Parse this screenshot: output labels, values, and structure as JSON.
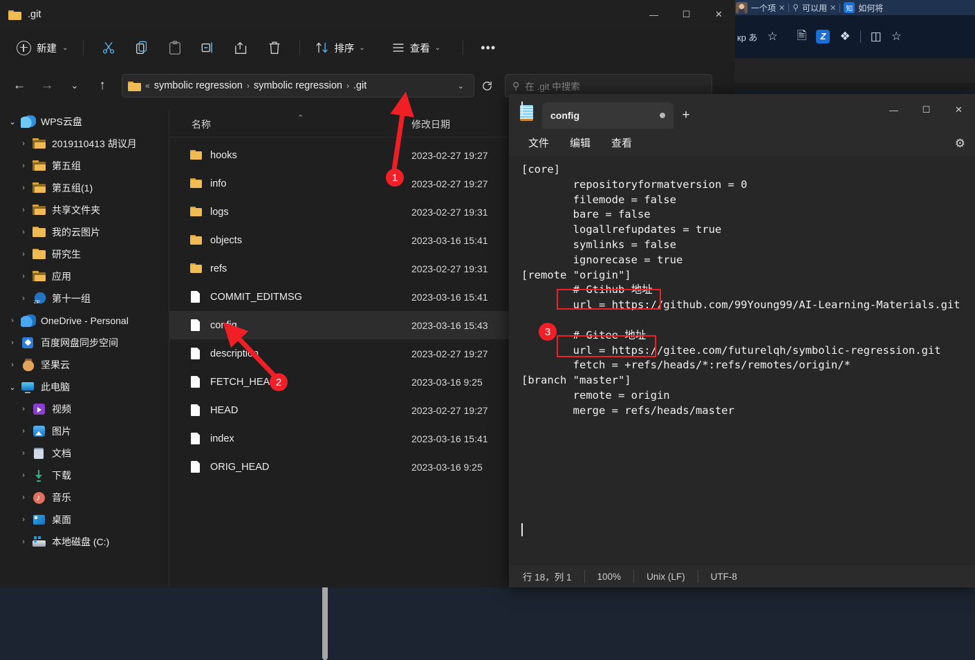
{
  "browser": {
    "tabs": [
      {
        "title": "一个项",
        "close": "✕"
      },
      {
        "title": "可以用",
        "close": "✕"
      },
      {
        "title": "如何将",
        "close": ""
      }
    ],
    "search_icon": "search-icon",
    "toolbar_icons": [
      "ime-indicator",
      "add-favorite-icon",
      "collections-icon",
      "zotero-icon",
      "extensions-icon",
      "split-screen-icon",
      "favorites-icon"
    ],
    "ime_label": "кр あ"
  },
  "explorer": {
    "title": ".git",
    "window_controls": {
      "minimize": "—",
      "maximize": "☐",
      "close": "✕"
    },
    "toolbar": {
      "new_label": "新建",
      "new_chevron": "⌄",
      "cut_icon": "cut-icon",
      "copy_icon": "copy-icon",
      "paste_icon": "paste-icon",
      "rename_icon": "rename-icon",
      "share_icon": "share-icon",
      "delete_icon": "delete-icon",
      "sort_label": "排序",
      "sort_icon": "sort-icon",
      "view_label": "查看",
      "view_icon": "view-icon",
      "more_label": "•••"
    },
    "nav": {
      "back": "←",
      "forward": "→",
      "recent": "⌄",
      "up": "↑",
      "refresh_icon": "refresh-icon",
      "breadcrumb_overflow": "«",
      "breadcrumb": [
        "symbolic regression",
        "symbolic regression",
        ".git"
      ],
      "breadcrumb_sep": "›",
      "breadcrumb_dropdown": "⌄",
      "search_placeholder": "在 .git 中搜索"
    },
    "navpane": [
      {
        "label": "WPS云盘",
        "icon": "cloud-wps-icon",
        "expander": "⌄",
        "expanded": true,
        "indent": 0
      },
      {
        "label": "2019110413 胡议月",
        "icon": "folder-shared-icon",
        "expander": "›",
        "indent": 1
      },
      {
        "label": "第五组",
        "icon": "folder-shared-icon",
        "expander": "›",
        "indent": 1
      },
      {
        "label": "第五组(1)",
        "icon": "folder-shared-icon",
        "expander": "›",
        "indent": 1
      },
      {
        "label": "共享文件夹",
        "icon": "folder-shared-icon",
        "expander": "›",
        "indent": 1
      },
      {
        "label": "我的云图片",
        "icon": "folder-icon",
        "expander": "›",
        "indent": 1
      },
      {
        "label": "研究生",
        "icon": "folder-icon",
        "expander": "›",
        "indent": 1
      },
      {
        "label": "应用",
        "icon": "folder-app-icon",
        "expander": "›",
        "indent": 1
      },
      {
        "label": "第十一组",
        "icon": "zip-icon",
        "expander": "›",
        "indent": 1
      },
      {
        "label": "OneDrive - Personal",
        "icon": "cloud-onedrive-icon",
        "expander": "›",
        "indent": 0
      },
      {
        "label": "百度网盘同步空间",
        "icon": "baidu-netdisk-icon",
        "expander": "›",
        "indent": 0
      },
      {
        "label": "坚果云",
        "icon": "nutstore-icon",
        "expander": "›",
        "indent": 0
      },
      {
        "label": "此电脑",
        "icon": "this-pc-icon",
        "expander": "⌄",
        "expanded": true,
        "indent": 0
      },
      {
        "label": "视频",
        "icon": "videos-icon",
        "expander": "›",
        "indent": 1
      },
      {
        "label": "图片",
        "icon": "pictures-icon",
        "expander": "›",
        "indent": 1
      },
      {
        "label": "文档",
        "icon": "documents-icon",
        "expander": "›",
        "indent": 1
      },
      {
        "label": "下载",
        "icon": "downloads-icon",
        "expander": "›",
        "indent": 1
      },
      {
        "label": "音乐",
        "icon": "music-icon",
        "expander": "›",
        "indent": 1
      },
      {
        "label": "桌面",
        "icon": "desktop-icon",
        "expander": "›",
        "indent": 1
      },
      {
        "label": "本地磁盘 (C:)",
        "icon": "disk-icon",
        "expander": "›",
        "indent": 1
      }
    ],
    "columns": {
      "name": "名称",
      "date": "修改日期",
      "sort_caret": "⌃"
    },
    "files": [
      {
        "name": "hooks",
        "date": "2023-02-27 19:27",
        "type": "folder",
        "selected": false
      },
      {
        "name": "info",
        "date": "2023-02-27 19:27",
        "type": "folder",
        "selected": false
      },
      {
        "name": "logs",
        "date": "2023-02-27 19:31",
        "type": "folder",
        "selected": false
      },
      {
        "name": "objects",
        "date": "2023-03-16 15:41",
        "type": "folder",
        "selected": false
      },
      {
        "name": "refs",
        "date": "2023-02-27 19:31",
        "type": "folder",
        "selected": false
      },
      {
        "name": "COMMIT_EDITMSG",
        "date": "2023-03-16 15:41",
        "type": "file",
        "selected": false
      },
      {
        "name": "config",
        "date": "2023-03-16 15:43",
        "type": "file",
        "selected": true
      },
      {
        "name": "description",
        "date": "2023-02-27 19:27",
        "type": "file",
        "selected": false
      },
      {
        "name": "FETCH_HEAD",
        "date": "2023-03-16 9:25",
        "type": "file",
        "selected": false
      },
      {
        "name": "HEAD",
        "date": "2023-02-27 19:27",
        "type": "file",
        "selected": false
      },
      {
        "name": "index",
        "date": "2023-03-16 15:41",
        "type": "file",
        "selected": false
      },
      {
        "name": "ORIG_HEAD",
        "date": "2023-03-16 9:25",
        "type": "file",
        "selected": false
      }
    ]
  },
  "notepad": {
    "app_icon": "notepad-icon",
    "tab_label": "config",
    "tab_modified_dot": "●",
    "new_tab": "+",
    "window_controls": {
      "minimize": "—",
      "maximize": "☐",
      "close": "✕"
    },
    "menus": [
      "文件",
      "编辑",
      "查看"
    ],
    "settings_icon": "gear-icon",
    "content": "[core]\n\trepositoryformatversion = 0\n\tfilemode = false\n\tbare = false\n\tlogallrefupdates = true\n\tsymlinks = false\n\tignorecase = true\n[remote \"origin\"]\n\t# Gtihub 地址\n\turl = https://github.com/99Young99/AI-Learning-Materials.git\n\n\t# Gitee 地址\n\turl = https://gitee.com/futurelqh/symbolic-regression.git\n\tfetch = +refs/heads/*:refs/remotes/origin/*\n[branch \"master\"]\n\tremote = origin\n\tmerge = refs/heads/master\n",
    "status": {
      "cursor": "行 18，列 1",
      "zoom": "100%",
      "line_ending": "Unix (LF)",
      "encoding": "UTF-8"
    }
  },
  "annotations": {
    "accent": "#ef1f26",
    "markers": [
      {
        "number": "1",
        "target": "breadcrumb .git"
      },
      {
        "number": "2",
        "target": "config file row"
      },
      {
        "number": "3",
        "target": "remote url comments"
      }
    ],
    "highlight_boxes": [
      "# Gtihub 地址",
      "# Gitee 地址"
    ]
  }
}
